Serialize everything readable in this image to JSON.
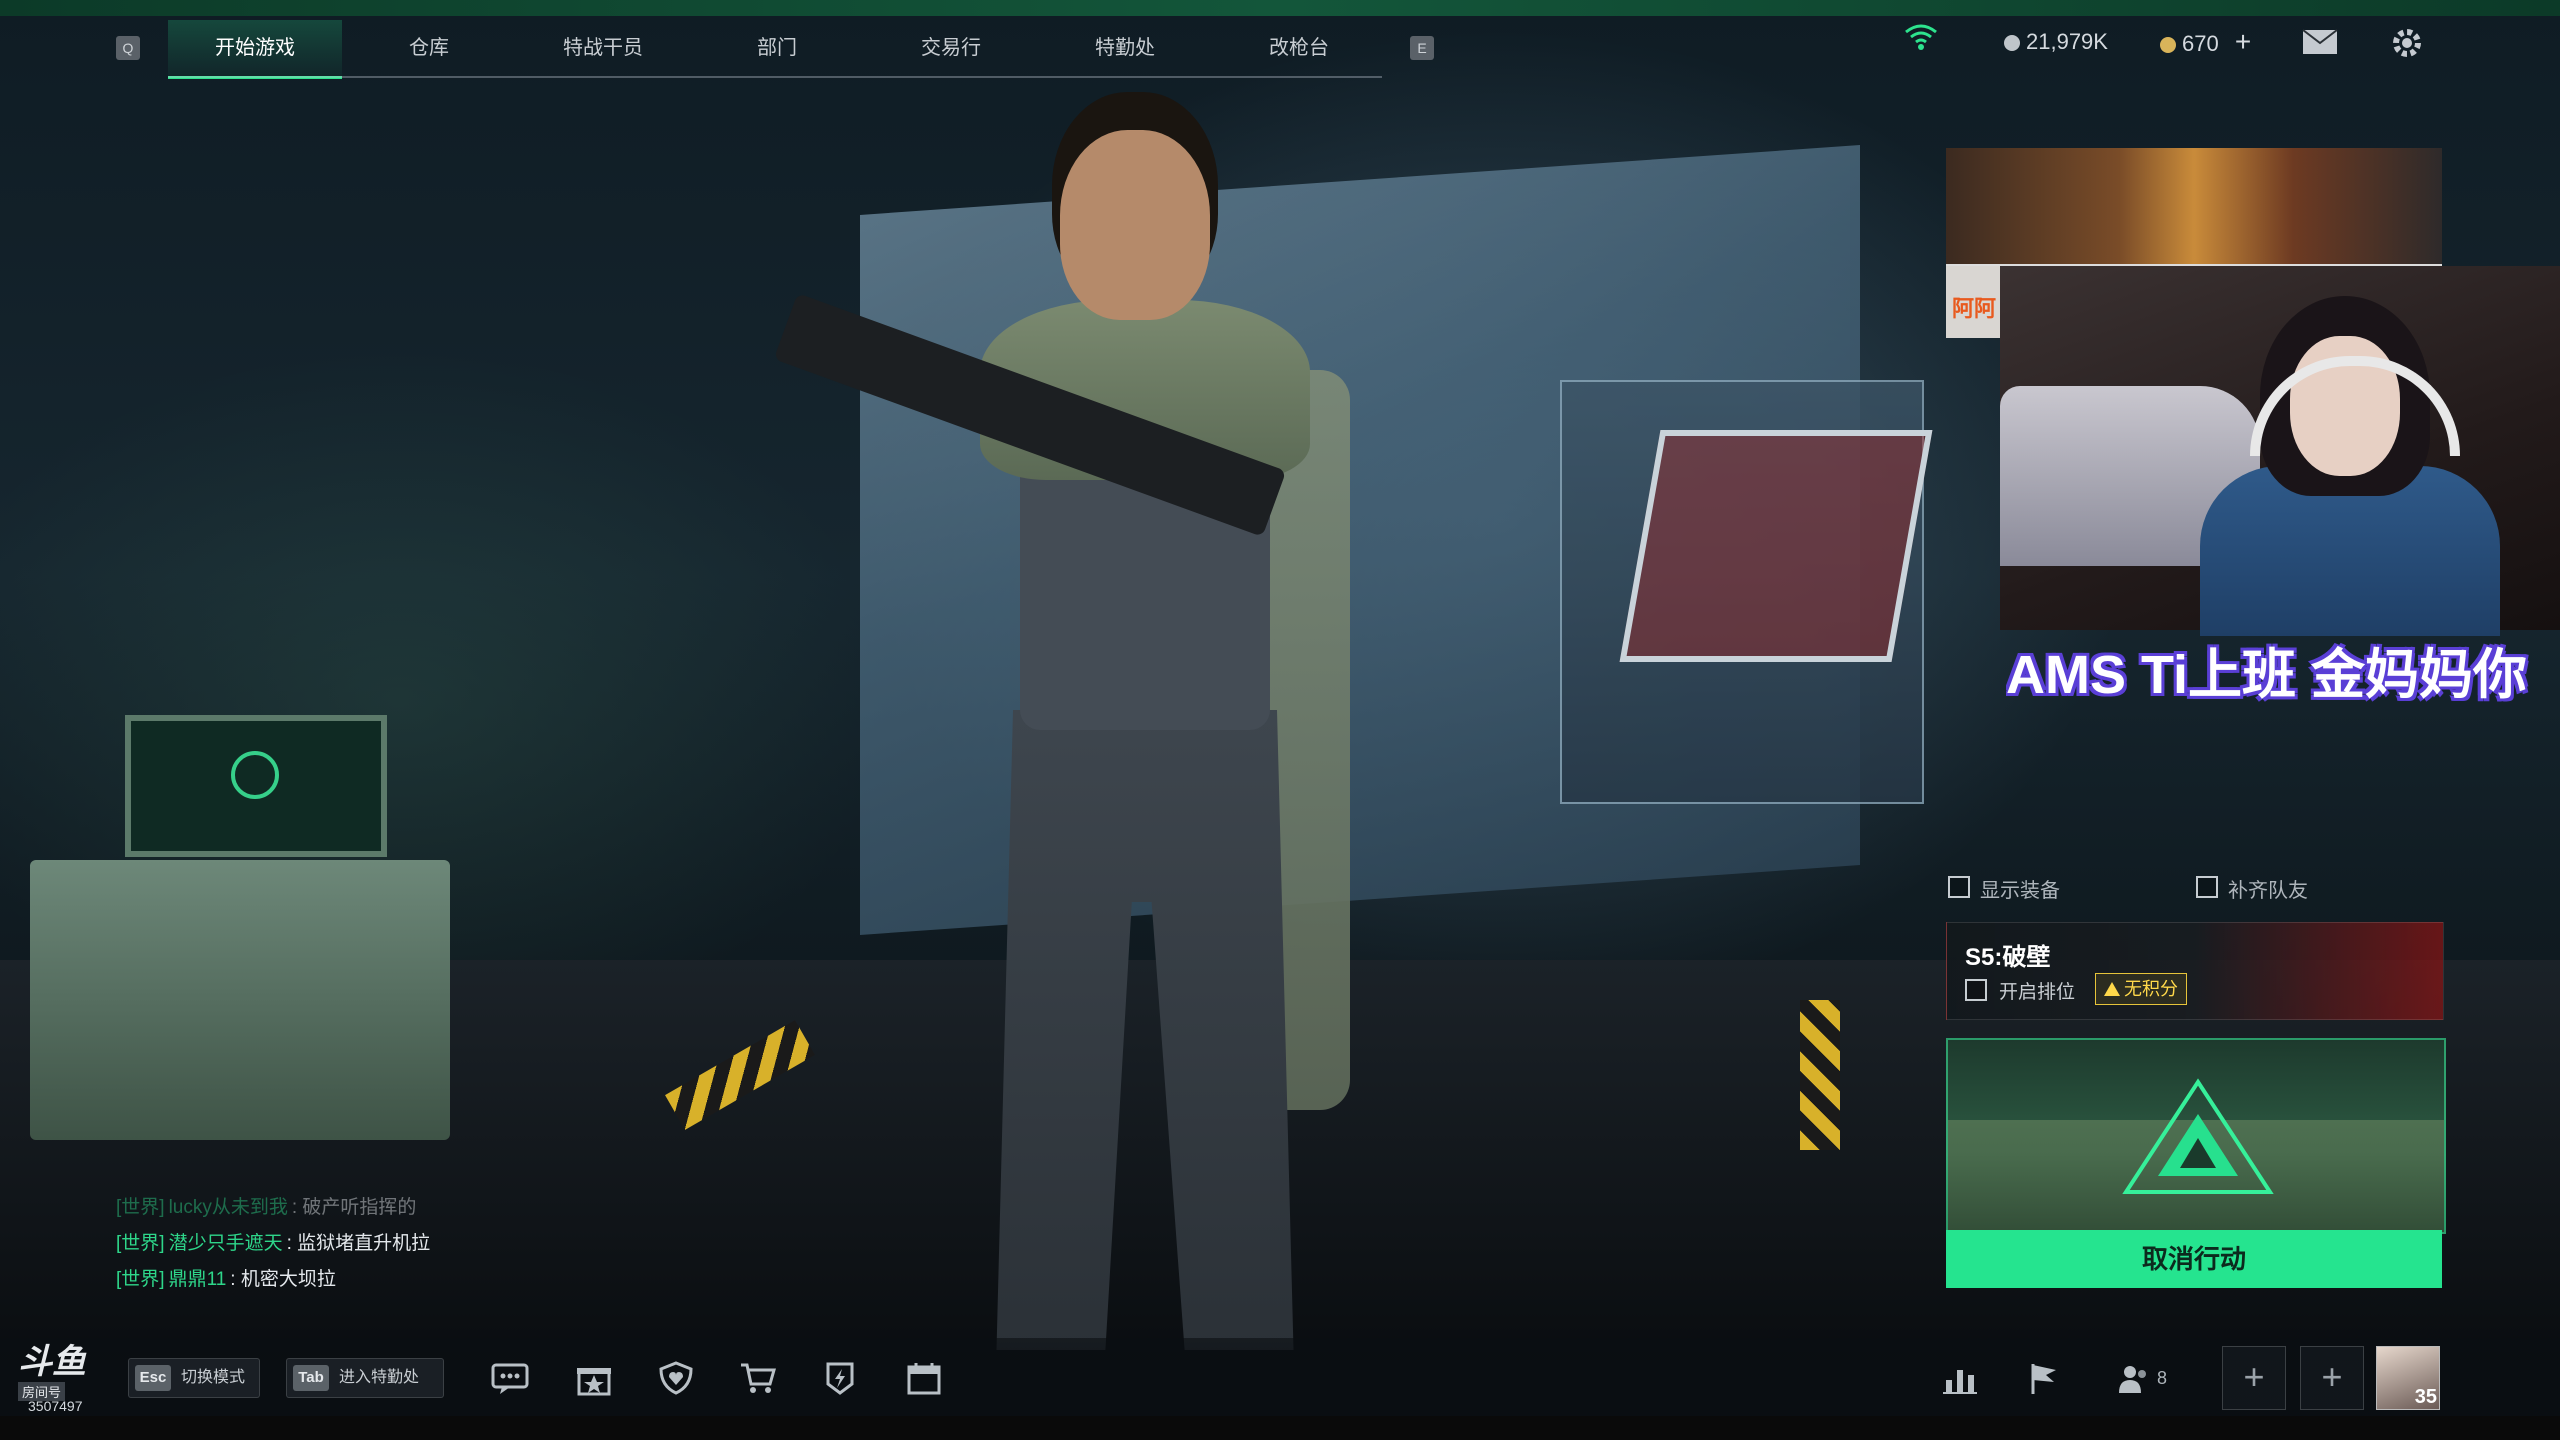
{
  "nav": {
    "left_key": "Q",
    "right_key": "E",
    "tabs": [
      {
        "label": "开始游戏",
        "active": true
      },
      {
        "label": "仓库",
        "active": false
      },
      {
        "label": "特战干员",
        "active": false
      },
      {
        "label": "部门",
        "active": false
      },
      {
        "label": "交易行",
        "active": false
      },
      {
        "label": "特勤处",
        "active": false
      },
      {
        "label": "改枪台",
        "active": false
      }
    ]
  },
  "currency": {
    "silver": "21,979K",
    "gold": "670",
    "gold_add": "+",
    "silver_color": "#bfc5ca",
    "gold_color": "#d9b45a"
  },
  "stream": {
    "side_text": "阿阿",
    "scroll_text": "AMS Ti上班 金妈妈你"
  },
  "options": {
    "show_gear": "显示装备",
    "fill_team": "补齐队友"
  },
  "season": {
    "title": "S5:破壁",
    "ranked_label": "开启排位",
    "no_points": "无积分"
  },
  "action": {
    "button": "取消行动",
    "accent": "#25e48f"
  },
  "chat": [
    {
      "channel": "[世界]",
      "user": "lucky从未到我",
      "message": "破产听指挥的",
      "faded": true
    },
    {
      "channel": "[世界]",
      "user": "潜少只手遮天",
      "message": "监狱堵直升机拉",
      "faded": false
    },
    {
      "channel": "[世界]",
      "user": "鼎鼎11",
      "message": "机密大坝拉",
      "faded": false
    }
  ],
  "bottom": {
    "esc_key": "Esc",
    "esc_label": "切换模式",
    "tab_key": "Tab",
    "tab_label": "进入特勤处",
    "squad_count": "8",
    "avatar_level": "35",
    "room_no": "3507497",
    "logo_text": "斗鱼",
    "logo_sub": "房间号",
    "icons": [
      "chat-icon",
      "gift-box-icon",
      "shield-heart-icon",
      "shop-cart-icon",
      "badge-icon",
      "calendar-icon"
    ],
    "right_icons": [
      "stats-icon",
      "flag-icon",
      "squad-icon"
    ]
  }
}
